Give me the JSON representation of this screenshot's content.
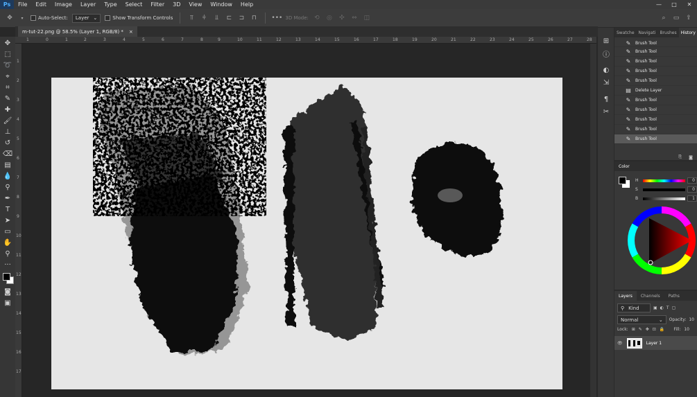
{
  "menu": [
    "File",
    "Edit",
    "Image",
    "Layer",
    "Type",
    "Select",
    "Filter",
    "3D",
    "View",
    "Window",
    "Help"
  ],
  "app_logo": "Ps",
  "options": {
    "auto_select_label": "Auto-Select:",
    "auto_select_value": "Layer",
    "transform_label": "Show Transform Controls",
    "mode_3d_label": "3D Mode:"
  },
  "document": {
    "tab_title": "m-tut-22.png @ 58.5% (Layer 1, RGB/8) *",
    "close": "×"
  },
  "ruler_top_labels": [
    "1",
    "0",
    "1",
    "2",
    "3",
    "4",
    "5",
    "6",
    "7",
    "8",
    "9",
    "10",
    "11",
    "12",
    "13",
    "14",
    "15",
    "16",
    "17",
    "18",
    "19",
    "20",
    "21",
    "22",
    "23",
    "24",
    "25",
    "26",
    "27",
    "28",
    "29"
  ],
  "ruler_left_labels": [
    "1",
    "2",
    "3",
    "4",
    "5",
    "6",
    "7",
    "8",
    "9",
    "10",
    "11",
    "12",
    "13",
    "14",
    "15",
    "16",
    "17"
  ],
  "panel_tabs": [
    "Swatche",
    "Navigati",
    "Brushes",
    "History"
  ],
  "history": [
    "Brush Tool",
    "Brush Tool",
    "Brush Tool",
    "Brush Tool",
    "Brush Tool",
    "Delete Layer",
    "Brush Tool",
    "Brush Tool",
    "Brush Tool",
    "Brush Tool",
    "Brush Tool"
  ],
  "color_panel": {
    "title": "Color",
    "h_label": "H",
    "s_label": "S",
    "b_label": "B",
    "h_value": "0",
    "s_value": "0",
    "b_value": "1"
  },
  "layers_panel": {
    "tabs": [
      "Layers",
      "Channels",
      "Paths"
    ],
    "kind": "Kind",
    "blend_mode": "Normal",
    "opacity_label": "Opacity:",
    "opacity_value": "10",
    "lock_label": "Lock:",
    "fill_label": "Fill:",
    "fill_value": "10",
    "layer_name": "Layer 1"
  },
  "colors": {
    "foreground": "#000000",
    "background": "#e6e6e6",
    "accent": "#4fb0ff"
  }
}
